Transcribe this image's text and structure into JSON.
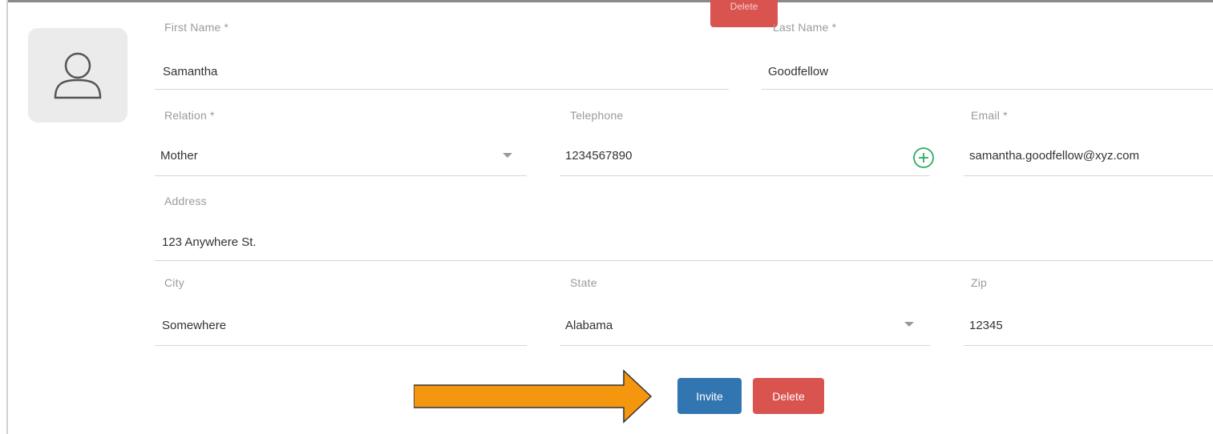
{
  "form": {
    "top_delete_label": "Delete",
    "first_name": {
      "label": "First Name *",
      "value": "Samantha"
    },
    "last_name": {
      "label": "Last Name *",
      "value": "Goodfellow"
    },
    "relation": {
      "label": "Relation *",
      "value": "Mother"
    },
    "telephone": {
      "label": "Telephone",
      "value": "1234567890"
    },
    "email": {
      "label": "Email *",
      "value": "samantha.goodfellow@xyz.com"
    },
    "address": {
      "label": "Address",
      "value": "123 Anywhere St."
    },
    "city": {
      "label": "City",
      "value": "Somewhere"
    },
    "state": {
      "label": "State",
      "value": "Alabama"
    },
    "zip": {
      "label": "Zip",
      "value": "12345"
    }
  },
  "actions": {
    "invite_label": "Invite",
    "delete_label": "Delete"
  },
  "icons": {
    "avatar": "user-icon",
    "add_phone": "plus-circle-icon",
    "pointer": "arrow-right-icon"
  },
  "colors": {
    "invite": "#3276b1",
    "delete": "#d9534f",
    "add_icon": "#27ae60",
    "arrow_fill": "#f5960f"
  }
}
